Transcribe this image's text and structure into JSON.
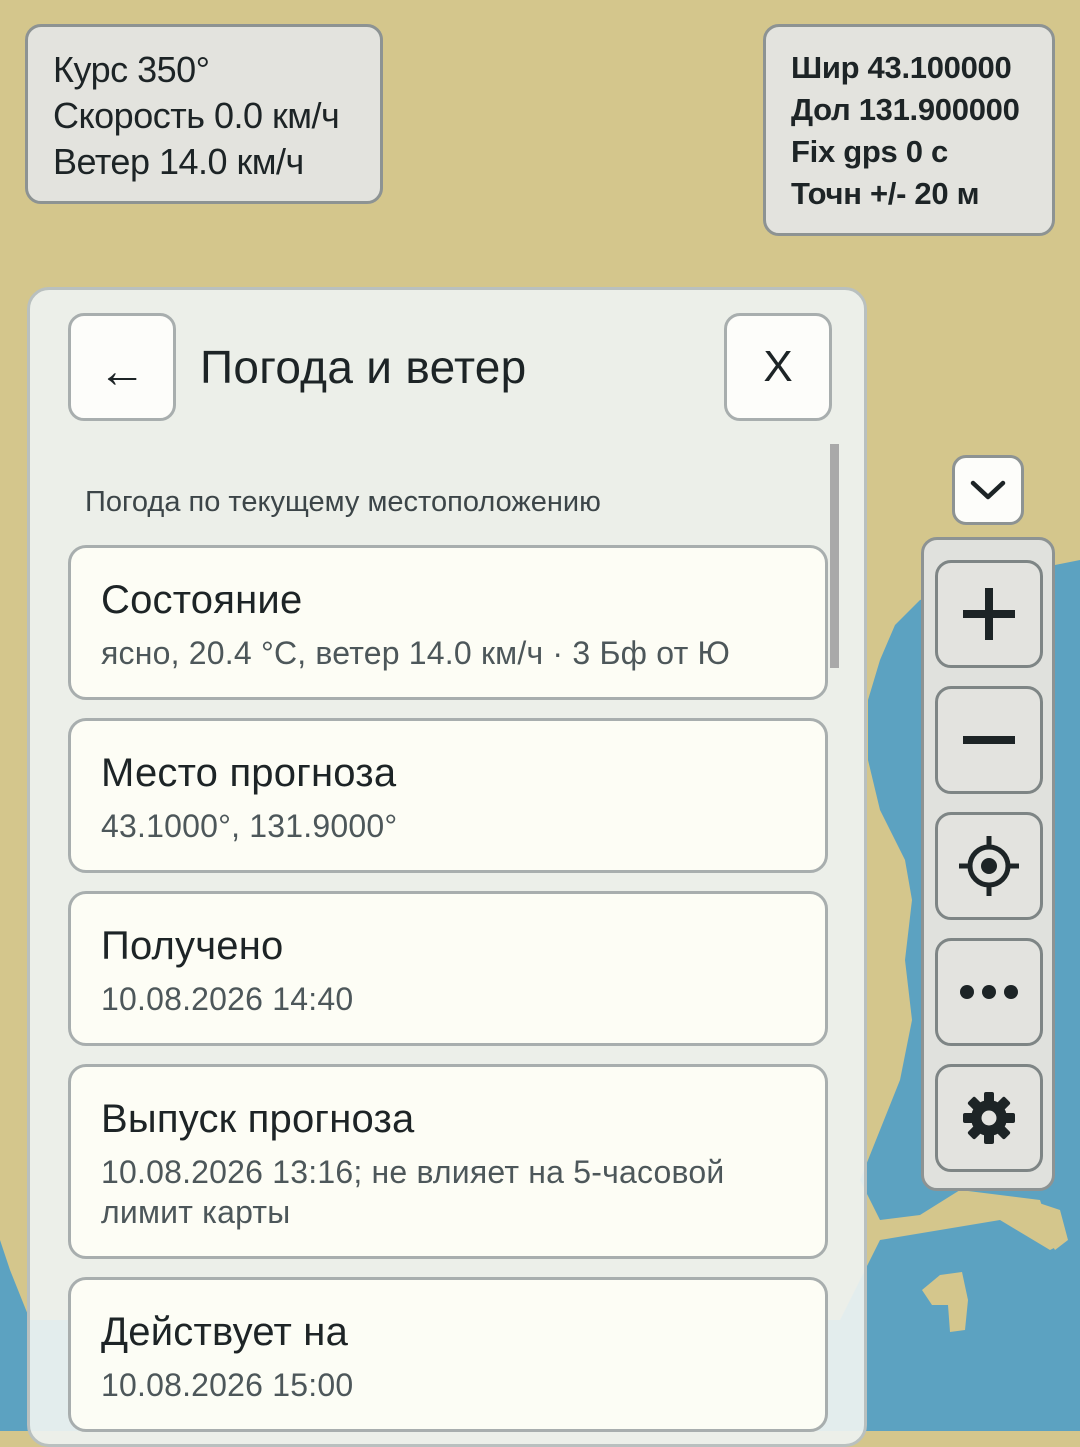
{
  "nav_info": {
    "course": "Курс 350°",
    "speed": "Скорость 0.0 км/ч",
    "wind": "Ветер 14.0 км/ч"
  },
  "gps_info": {
    "latitude": "Шир 43.100000",
    "longitude": "Дол 131.900000",
    "fix": "Fix gps 0 с",
    "accuracy": "Точн +/- 20 м"
  },
  "panel": {
    "back_label": "←",
    "title": "Погода и ветер",
    "close_label": "X",
    "section_label": "Погода по текущему местоположению",
    "cards": [
      {
        "title": "Состояние",
        "value": "ясно, 20.4 °C, ветер 14.0 км/ч · 3 Бф от Ю"
      },
      {
        "title": "Место прогноза",
        "value": "43.1000°, 131.9000°"
      },
      {
        "title": "Получено",
        "value": "10.08.2026 14:40"
      },
      {
        "title": "Выпуск прогноза",
        "value": "10.08.2026 13:16; не влияет на 5-часовой лимит карты"
      },
      {
        "title": "Действует на",
        "value": "10.08.2026 15:00"
      }
    ]
  },
  "toolbar": {
    "collapse_icon": "chevron-down-icon",
    "buttons": [
      "plus-icon",
      "minus-icon",
      "crosshair-icon",
      "more-icon",
      "gear-icon"
    ]
  },
  "colors": {
    "land": "#d4c68c",
    "water": "#5ca2c1",
    "text": "#1d2426"
  }
}
